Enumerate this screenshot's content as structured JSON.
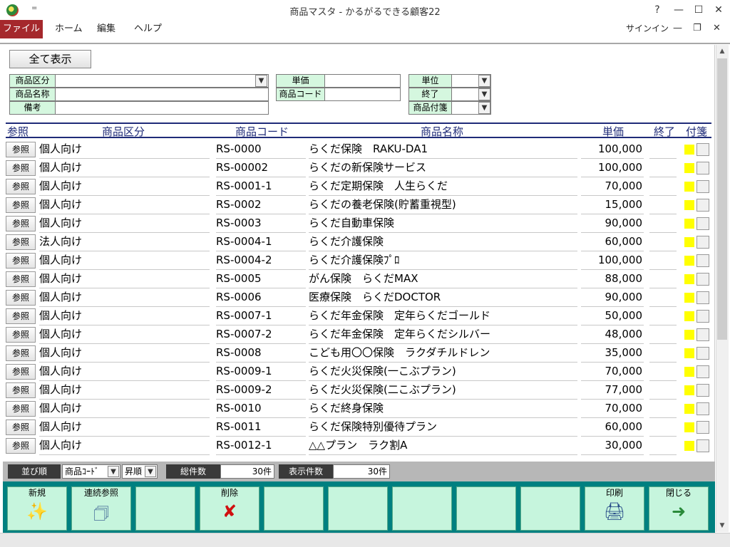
{
  "window": {
    "title": "商品マスタ - かるがるできる顧客22",
    "help": "?",
    "qat": "=",
    "signin": "サインイン"
  },
  "ribbon": {
    "tabs": [
      "ファイル",
      "ホーム",
      "編集",
      "ヘルプ"
    ]
  },
  "form": {
    "show_all": "全て表示",
    "filters": {
      "category": "商品区分",
      "name": "商品名称",
      "memo": "備考",
      "price": "単価",
      "code": "商品コード",
      "unit": "単位",
      "ended": "終了",
      "tag": "商品付箋"
    },
    "columns": [
      "参照",
      "商品区分",
      "商品コード",
      "商品名称",
      "単価",
      "終了",
      "付箋"
    ],
    "ref_label": "参照",
    "rows": [
      {
        "cat": "個人向け",
        "code": "RS-0000",
        "name": "らくだ保険　RAKU-DA1",
        "price": "100,000"
      },
      {
        "cat": "個人向け",
        "code": "RS-00002",
        "name": "らくだの新保険サービス",
        "price": "100,000"
      },
      {
        "cat": "個人向け",
        "code": "RS-0001-1",
        "name": "らくだ定期保険　人生らくだ",
        "price": "70,000"
      },
      {
        "cat": "個人向け",
        "code": "RS-0002",
        "name": "らくだの養老保険(貯蓄重視型)",
        "price": "15,000"
      },
      {
        "cat": "個人向け",
        "code": "RS-0003",
        "name": "らくだ自動車保険",
        "price": "90,000"
      },
      {
        "cat": "法人向け",
        "code": "RS-0004-1",
        "name": "らくだ介護保険",
        "price": "60,000"
      },
      {
        "cat": "個人向け",
        "code": "RS-0004-2",
        "name": "らくだ介護保険ﾌﾟﾛ",
        "price": "100,000"
      },
      {
        "cat": "個人向け",
        "code": "RS-0005",
        "name": "がん保険　らくだMAX",
        "price": "88,000"
      },
      {
        "cat": "個人向け",
        "code": "RS-0006",
        "name": "医療保険　らくだDOCTOR",
        "price": "90,000"
      },
      {
        "cat": "個人向け",
        "code": "RS-0007-1",
        "name": "らくだ年金保険　定年らくだゴールド",
        "price": "50,000"
      },
      {
        "cat": "個人向け",
        "code": "RS-0007-2",
        "name": "らくだ年金保険　定年らくだシルバー",
        "price": "48,000"
      },
      {
        "cat": "個人向け",
        "code": "RS-0008",
        "name": "こども用〇〇保険　ラクダチルドレン",
        "price": "35,000"
      },
      {
        "cat": "個人向け",
        "code": "RS-0009-1",
        "name": "らくだ火災保険(一こぶプラン)",
        "price": "70,000"
      },
      {
        "cat": "個人向け",
        "code": "RS-0009-2",
        "name": "らくだ火災保険(二こぶプラン)",
        "price": "77,000"
      },
      {
        "cat": "個人向け",
        "code": "RS-0010",
        "name": "らくだ終身保険",
        "price": "70,000"
      },
      {
        "cat": "個人向け",
        "code": "RS-0011",
        "name": "らくだ保険特別優待プラン",
        "price": "60,000"
      },
      {
        "cat": "個人向け",
        "code": "RS-0012-1",
        "name": "△△プラン　ラク割A",
        "price": "30,000"
      }
    ]
  },
  "sortbar": {
    "sort_label": "並び順",
    "sort_field": "商品ｺｰﾄﾞ",
    "sort_order": "昇順",
    "total_label": "総件数",
    "total_value": "30件",
    "shown_label": "表示件数",
    "shown_value": "30件"
  },
  "toolbar": {
    "new": "新規",
    "bulk_ref": "連続参照",
    "delete": "削除",
    "print": "印刷",
    "close": "閉じる"
  },
  "colors": {
    "file_tab": "#a5282c",
    "label_bg": "#d5f7df",
    "toolbar_bg": "#008080",
    "tag_yellow": "#ffff00",
    "header_navy": "#1f2b78"
  }
}
